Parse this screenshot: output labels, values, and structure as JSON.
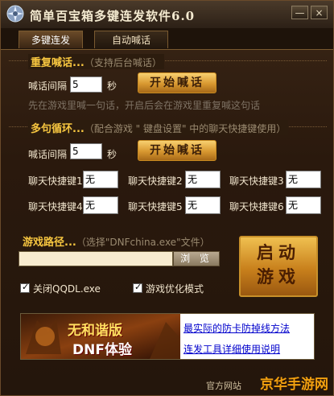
{
  "window": {
    "title": "简单百宝箱多键连发软件6.0",
    "min_label": "—",
    "close_label": "×"
  },
  "tabs": [
    {
      "label": "多键连发",
      "active": true
    },
    {
      "label": "自动喊话",
      "active": false
    }
  ],
  "repeat": {
    "title": "重复喊话...",
    "hint": "（支持后台喊话）",
    "interval_label": "喊话间隔",
    "interval_value": "5",
    "unit": "秒",
    "start_label": "开始喊话",
    "desc": "先在游戏里喊一句话，开启后会在游戏里重复喊这句话"
  },
  "loop": {
    "title": "多句循环...",
    "hint": "（配合游戏 \" 键盘设置\" 中的聊天快捷键使用）",
    "interval_label": "喊话间隔",
    "interval_value": "5",
    "unit": "秒",
    "start_label": "开始喊话",
    "keys": [
      {
        "label": "聊天快捷键1",
        "value": "无"
      },
      {
        "label": "聊天快捷键2",
        "value": "无"
      },
      {
        "label": "聊天快捷键3",
        "value": "无"
      },
      {
        "label": "聊天快捷键4",
        "value": "无"
      },
      {
        "label": "聊天快捷键5",
        "value": "无"
      },
      {
        "label": "聊天快捷键6",
        "value": "无"
      }
    ]
  },
  "game": {
    "title": "游戏路径...",
    "hint": "（选择\"DNFchina.exe\"文件）",
    "path_value": "",
    "browse_label": "浏 览",
    "launch_line1": "启动",
    "launch_line2": "游戏",
    "close_qqdl_label": "关闭QQDL.exe",
    "close_qqdl_checked": true,
    "optimize_label": "游戏优化模式",
    "optimize_checked": true
  },
  "ad": {
    "banner_line1": "无和谐版",
    "banner_line2": "DNF体验",
    "link1": "最实际的防卡防掉线方法",
    "link2": "连发工具详细使用说明"
  },
  "footer": {
    "site_label": "官方网站",
    "watermark": "京华手游网"
  },
  "colors": {
    "accent_gold": "#f7c640",
    "button_gold": "#d89830",
    "link_blue": "#0000cc",
    "background": "#2a190d"
  }
}
